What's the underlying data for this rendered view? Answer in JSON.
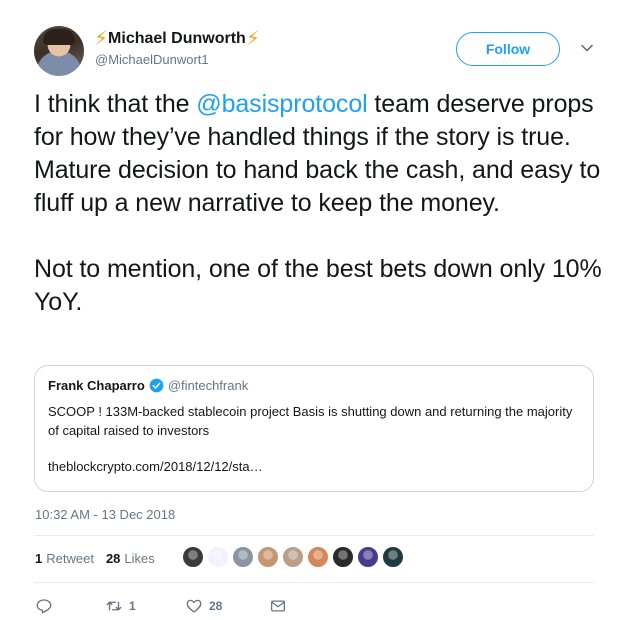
{
  "author": {
    "name": "Michael Dunworth",
    "prefix_emoji": "⚡",
    "suffix_emoji": "⚡",
    "handle": "@MichaelDunwort1",
    "avatar": "profile-photo"
  },
  "header": {
    "follow_label": "Follow",
    "caret_icon": "chevron-down-icon"
  },
  "tweet": {
    "line1_before": "I think that the ",
    "mention": "@basisprotocol",
    "line1_after": " team deserve props for how they’ve handled things if the story is true. Mature decision to hand back the cash, and easy to fluff up a new narrative to keep the money.",
    "paragraph2": "Not to mention, one of the best bets down only 10% YoY."
  },
  "quote": {
    "name": "Frank Chaparro",
    "verified_icon": "verified-badge-icon",
    "handle": "@fintechfrank",
    "text": "SCOOP ! 133M-backed stablecoin project Basis is shutting down and returning the majority of capital raised to investors",
    "link": "theblockcrypto.com/2018/12/12/sta…"
  },
  "timestamp": "10:32 AM - 13 Dec 2018",
  "stats": {
    "retweets_count": "1",
    "retweets_label": "Retweet",
    "likes_count": "28",
    "likes_label": "Likes"
  },
  "likers": [
    {
      "color": "#3b3b3b"
    },
    {
      "color": "#f4f0ff"
    },
    {
      "color": "#8a96a3"
    },
    {
      "color": "#c7956f"
    },
    {
      "color": "#b8a08c"
    },
    {
      "color": "#d4875a"
    },
    {
      "color": "#2a2a2a"
    },
    {
      "color": "#4b3b8f"
    },
    {
      "color": "#1f3b3f"
    }
  ],
  "actions": {
    "reply_icon": "reply-icon",
    "retweet_icon": "retweet-icon",
    "retweet_count": "1",
    "like_icon": "heart-icon",
    "like_count": "28",
    "message_icon": "envelope-icon"
  },
  "colors": {
    "accent": "#1da1f2",
    "text": "#14171a",
    "secondary": "#657786",
    "bolt": "#f5a623",
    "border": "#ccd6dd"
  }
}
